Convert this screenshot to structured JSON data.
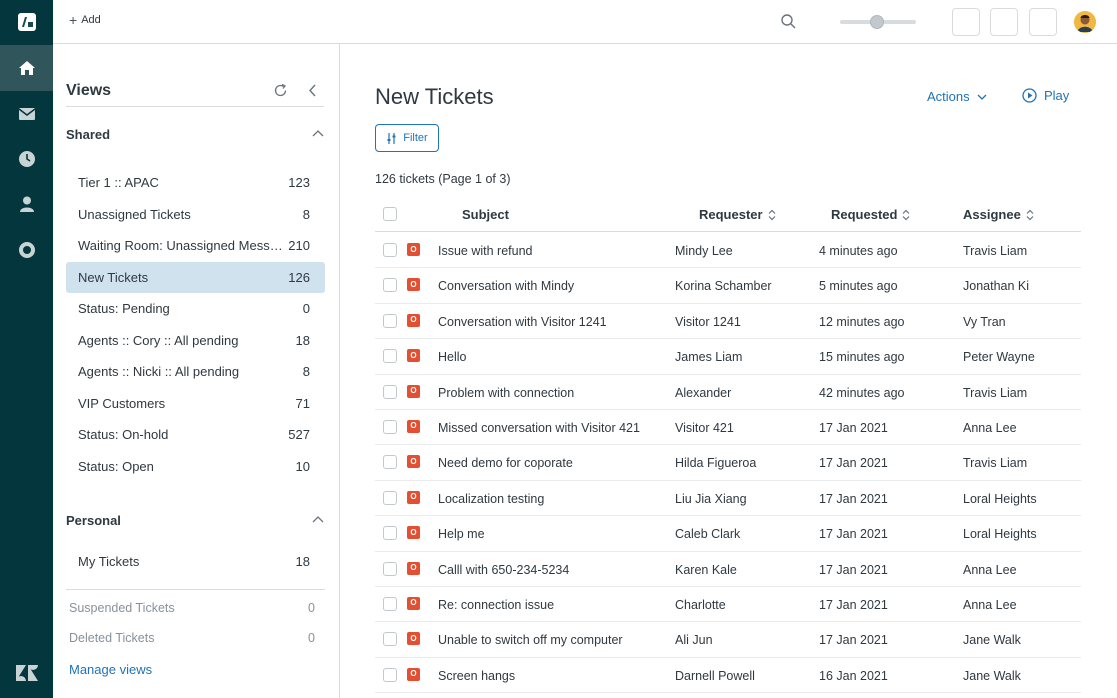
{
  "topbar": {
    "add_label": "Add"
  },
  "views_panel": {
    "title": "Views",
    "shared_label": "Shared",
    "shared_items": [
      {
        "name": "Tier 1 :: APAC",
        "count": "123"
      },
      {
        "name": "Unassigned Tickets",
        "count": "8"
      },
      {
        "name": "Waiting Room: Unassigned Messa...",
        "count": "210"
      },
      {
        "name": "New Tickets",
        "count": "126"
      },
      {
        "name": "Status: Pending",
        "count": "0"
      },
      {
        "name": "Agents :: Cory :: All pending",
        "count": "18"
      },
      {
        "name": "Agents :: Nicki :: All pending",
        "count": "8"
      },
      {
        "name": "VIP Customers",
        "count": "71"
      },
      {
        "name": "Status: On-hold",
        "count": "527"
      },
      {
        "name": "Status: Open",
        "count": "10"
      }
    ],
    "personal_label": "Personal",
    "personal_items": [
      {
        "name": "My Tickets",
        "count": "18"
      }
    ],
    "suspended": {
      "name": "Suspended Tickets",
      "count": "0"
    },
    "deleted": {
      "name": "Deleted Tickets",
      "count": "0"
    },
    "manage_label": "Manage views"
  },
  "main": {
    "title": "New Tickets",
    "actions_label": "Actions",
    "play_label": "Play",
    "filter_label": "Filter",
    "count_text": "126 tickets (Page 1 of 3)",
    "columns": {
      "subject": "Subject",
      "requester": "Requester",
      "requested": "Requested",
      "assignee": "Assignee"
    },
    "status_letter": "O",
    "tickets": [
      {
        "subject": "Issue with refund",
        "requester": "Mindy Lee",
        "requested": "4 minutes ago",
        "assignee": "Travis Liam"
      },
      {
        "subject": "Conversation with Mindy",
        "requester": "Korina Schamber",
        "requested": "5 minutes ago",
        "assignee": "Jonathan Ki"
      },
      {
        "subject": "Conversation with Visitor 1241",
        "requester": "Visitor 1241",
        "requested": "12 minutes ago",
        "assignee": "Vy Tran"
      },
      {
        "subject": "Hello",
        "requester": "James Liam",
        "requested": "15 minutes ago",
        "assignee": "Peter Wayne"
      },
      {
        "subject": "Problem with connection",
        "requester": "Alexander",
        "requested": "42 minutes ago",
        "assignee": "Travis Liam"
      },
      {
        "subject": "Missed conversation with Visitor 421",
        "requester": "Visitor 421",
        "requested": "17 Jan 2021",
        "assignee": "Anna Lee"
      },
      {
        "subject": "Need demo for coporate",
        "requester": "Hilda Figueroa",
        "requested": "17 Jan 2021",
        "assignee": "Travis Liam"
      },
      {
        "subject": "Localization testing",
        "requester": "Liu Jia Xiang",
        "requested": "17 Jan 2021",
        "assignee": "Loral Heights"
      },
      {
        "subject": "Help me",
        "requester": "Caleb Clark",
        "requested": "17 Jan 2021",
        "assignee": "Loral Heights"
      },
      {
        "subject": "Calll with 650-234-5234",
        "requester": "Karen Kale",
        "requested": "17 Jan 2021",
        "assignee": "Anna Lee"
      },
      {
        "subject": "Re: connection issue",
        "requester": "Charlotte",
        "requested": "17 Jan 2021",
        "assignee": "Anna Lee"
      },
      {
        "subject": "Unable to switch off my computer",
        "requester": "Ali Jun",
        "requested": "17 Jan 2021",
        "assignee": "Jane Walk"
      },
      {
        "subject": "Screen hangs",
        "requester": "Darnell Powell",
        "requested": "16 Jan 2021",
        "assignee": "Jane Walk"
      },
      {
        "subject": "",
        "requester": "",
        "requested": "",
        "assignee": ""
      }
    ]
  },
  "colors": {
    "rail": "#03363d",
    "rail_active": "#30555a",
    "accent": "#1f73b7",
    "selected_view": "#d1e2ef",
    "status_open": "#e34f32"
  }
}
